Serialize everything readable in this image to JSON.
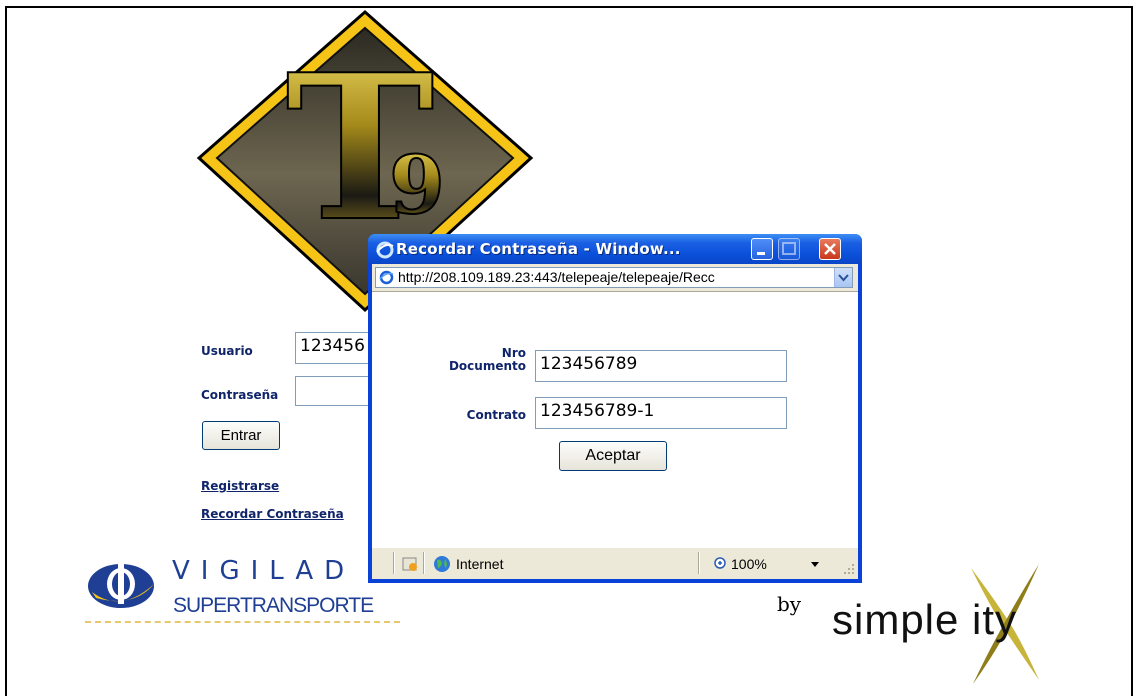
{
  "login": {
    "user_label": "Usuario",
    "user_value": "123456",
    "pass_label": "Contraseña",
    "pass_value": "",
    "submit_label": "Entrar",
    "register_link": "Registrarse",
    "recover_link": "Recordar Contraseña"
  },
  "logos": {
    "t9_alt": "T9",
    "vigilado_title": "VIGILAD",
    "vigilado_sub": "SUPERTRANSPORTE",
    "by_text": "by",
    "simplexity_text": "simple  ity"
  },
  "popup": {
    "title": "Recordar Contraseña - Window...",
    "address": "http://208.109.189.23:443/telepeaje/telepeaje/Recc",
    "doc_label_line1": "Nro",
    "doc_label_line2": "Documento",
    "doc_value": "123456789",
    "contract_label": "Contrato",
    "contract_value": "123456789-1",
    "accept_label": "Aceptar",
    "status_zone": "Internet",
    "zoom": "100%"
  },
  "colors": {
    "label_blue": "#10246a",
    "title_blue": "#0a4fd9",
    "logo_gold": "#f5c417",
    "vigilado_blue": "#1f3f94"
  }
}
